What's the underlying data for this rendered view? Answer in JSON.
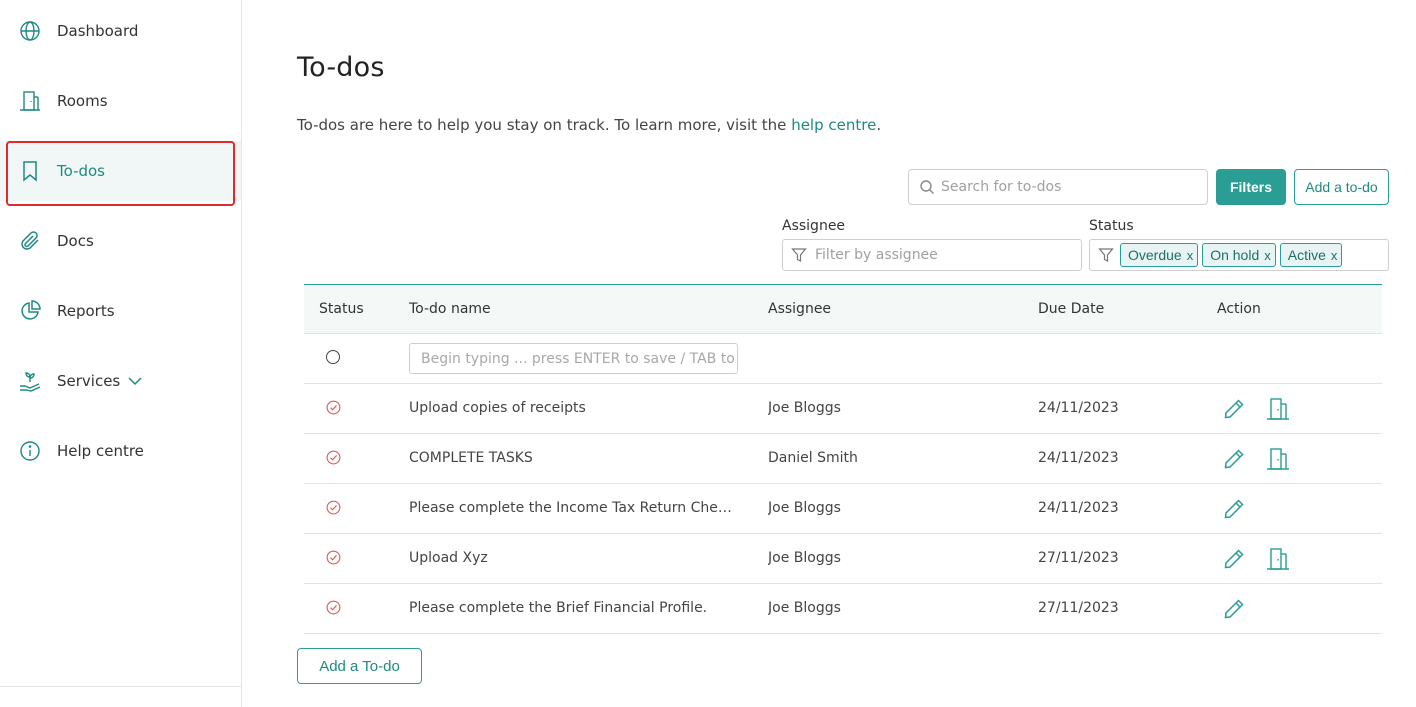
{
  "sidebar": {
    "items": [
      {
        "label": "Dashboard",
        "icon": "globe-icon"
      },
      {
        "label": "Rooms",
        "icon": "building-icon"
      },
      {
        "label": "To-dos",
        "icon": "bookmark-icon",
        "active": true
      },
      {
        "label": "Docs",
        "icon": "paperclip-icon"
      },
      {
        "label": "Reports",
        "icon": "pie-chart-icon"
      },
      {
        "label": "Services",
        "icon": "hand-plant-icon",
        "has_dropdown": true
      },
      {
        "label": "Help centre",
        "icon": "info-icon"
      }
    ]
  },
  "page": {
    "title": "To-dos",
    "intro_text": "To-dos are here to help you stay on track. To learn more, visit the ",
    "intro_link": "help centre",
    "intro_end": "."
  },
  "toolbar": {
    "search_placeholder": "Search for to-dos",
    "filters_label": "Filters",
    "add_label": "Add a to-do"
  },
  "filters": {
    "assignee_label": "Assignee",
    "assignee_placeholder": "Filter by assignee",
    "status_label": "Status",
    "status_chips": [
      "Overdue",
      "On hold",
      "Active"
    ],
    "chip_remove": "x"
  },
  "table": {
    "columns": [
      "Status",
      "To-do name",
      "Assignee",
      "Due Date",
      "Action"
    ],
    "new_row_placeholder": "Begin typing ... press ENTER to save / TAB to m...",
    "rows": [
      {
        "name": "Upload copies of receipts",
        "assignee": "Joe Bloggs",
        "due": "24/11/2023",
        "has_room": true
      },
      {
        "name": "COMPLETE TASKS",
        "assignee": "Daniel Smith",
        "due": "24/11/2023",
        "has_room": true
      },
      {
        "name": "Please complete the Income Tax Return Checklist ...",
        "assignee": "Joe Bloggs",
        "due": "24/11/2023",
        "has_room": false
      },
      {
        "name": "Upload Xyz",
        "assignee": "Joe Bloggs",
        "due": "27/11/2023",
        "has_room": true
      },
      {
        "name": "Please complete the Brief Financial Profile.",
        "assignee": "Joe Bloggs",
        "due": "27/11/2023",
        "has_room": false
      }
    ]
  },
  "footer": {
    "add_button": "Add a To-do"
  },
  "colors": {
    "accent": "#2a9d94",
    "accent_text": "#1f8a80",
    "status_overdue": "#e05a5a",
    "highlight": "#e02b2b"
  }
}
